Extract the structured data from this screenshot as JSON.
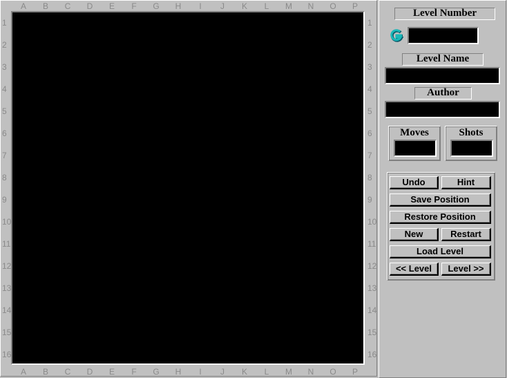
{
  "board": {
    "columns": [
      "A",
      "B",
      "C",
      "D",
      "E",
      "F",
      "G",
      "H",
      "I",
      "J",
      "K",
      "L",
      "M",
      "N",
      "O",
      "P"
    ],
    "rows": [
      "1",
      "2",
      "3",
      "4",
      "5",
      "6",
      "7",
      "8",
      "9",
      "10",
      "11",
      "12",
      "13",
      "14",
      "15",
      "16"
    ]
  },
  "panel": {
    "level_number_label": "Level Number",
    "level_number_value": "",
    "level_name_label": "Level Name",
    "level_name_value": "",
    "author_label": "Author",
    "author_value": "",
    "moves_label": "Moves",
    "moves_value": "",
    "shots_label": "Shots",
    "shots_value": "",
    "icon": "g-logo-icon"
  },
  "buttons": {
    "undo": "Undo",
    "hint": "Hint",
    "save_position": "Save Position",
    "restore_position": "Restore Position",
    "new": "New",
    "restart": "Restart",
    "load_level": "Load Level",
    "prev_level": "<< Level",
    "next_level": "Level >>"
  }
}
